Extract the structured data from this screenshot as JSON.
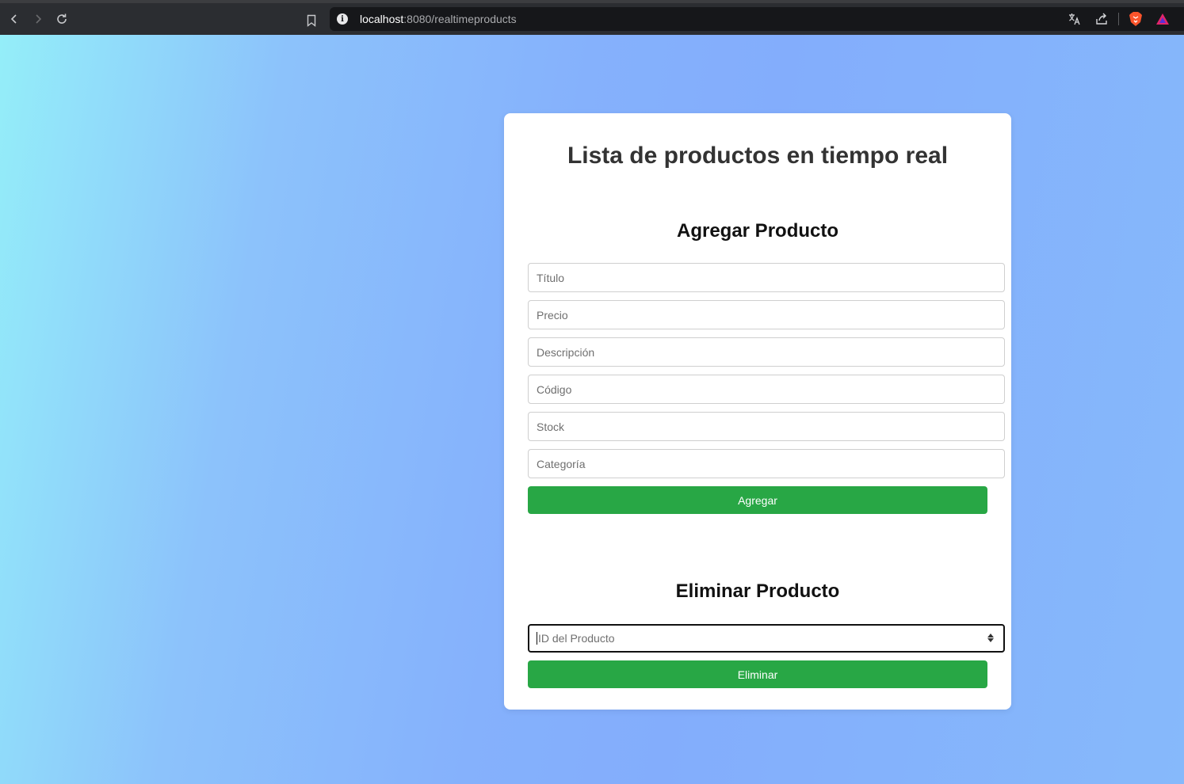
{
  "browser": {
    "url_host": "localhost",
    "url_path": ":8080/realtimeproducts",
    "icons": [
      "back-icon",
      "forward-icon",
      "reload-icon",
      "bookmark-icon",
      "info-icon",
      "translate-icon",
      "share-icon",
      "brave-shield-icon",
      "brave-rewards-icon"
    ]
  },
  "page": {
    "title": "Lista de productos en tiempo real",
    "add_section": {
      "title": "Agregar Producto",
      "fields": [
        {
          "placeholder": "Título",
          "value": ""
        },
        {
          "placeholder": "Precio",
          "value": ""
        },
        {
          "placeholder": "Descripción",
          "value": ""
        },
        {
          "placeholder": "Código",
          "value": ""
        },
        {
          "placeholder": "Stock",
          "value": ""
        },
        {
          "placeholder": "Categoría",
          "value": ""
        }
      ],
      "button_label": "Agregar"
    },
    "delete_section": {
      "title": "Eliminar Producto",
      "field": {
        "placeholder": "ID del Producto",
        "value": ""
      },
      "button_label": "Eliminar"
    }
  },
  "colors": {
    "button": "#28a745",
    "card": "#ffffff"
  }
}
